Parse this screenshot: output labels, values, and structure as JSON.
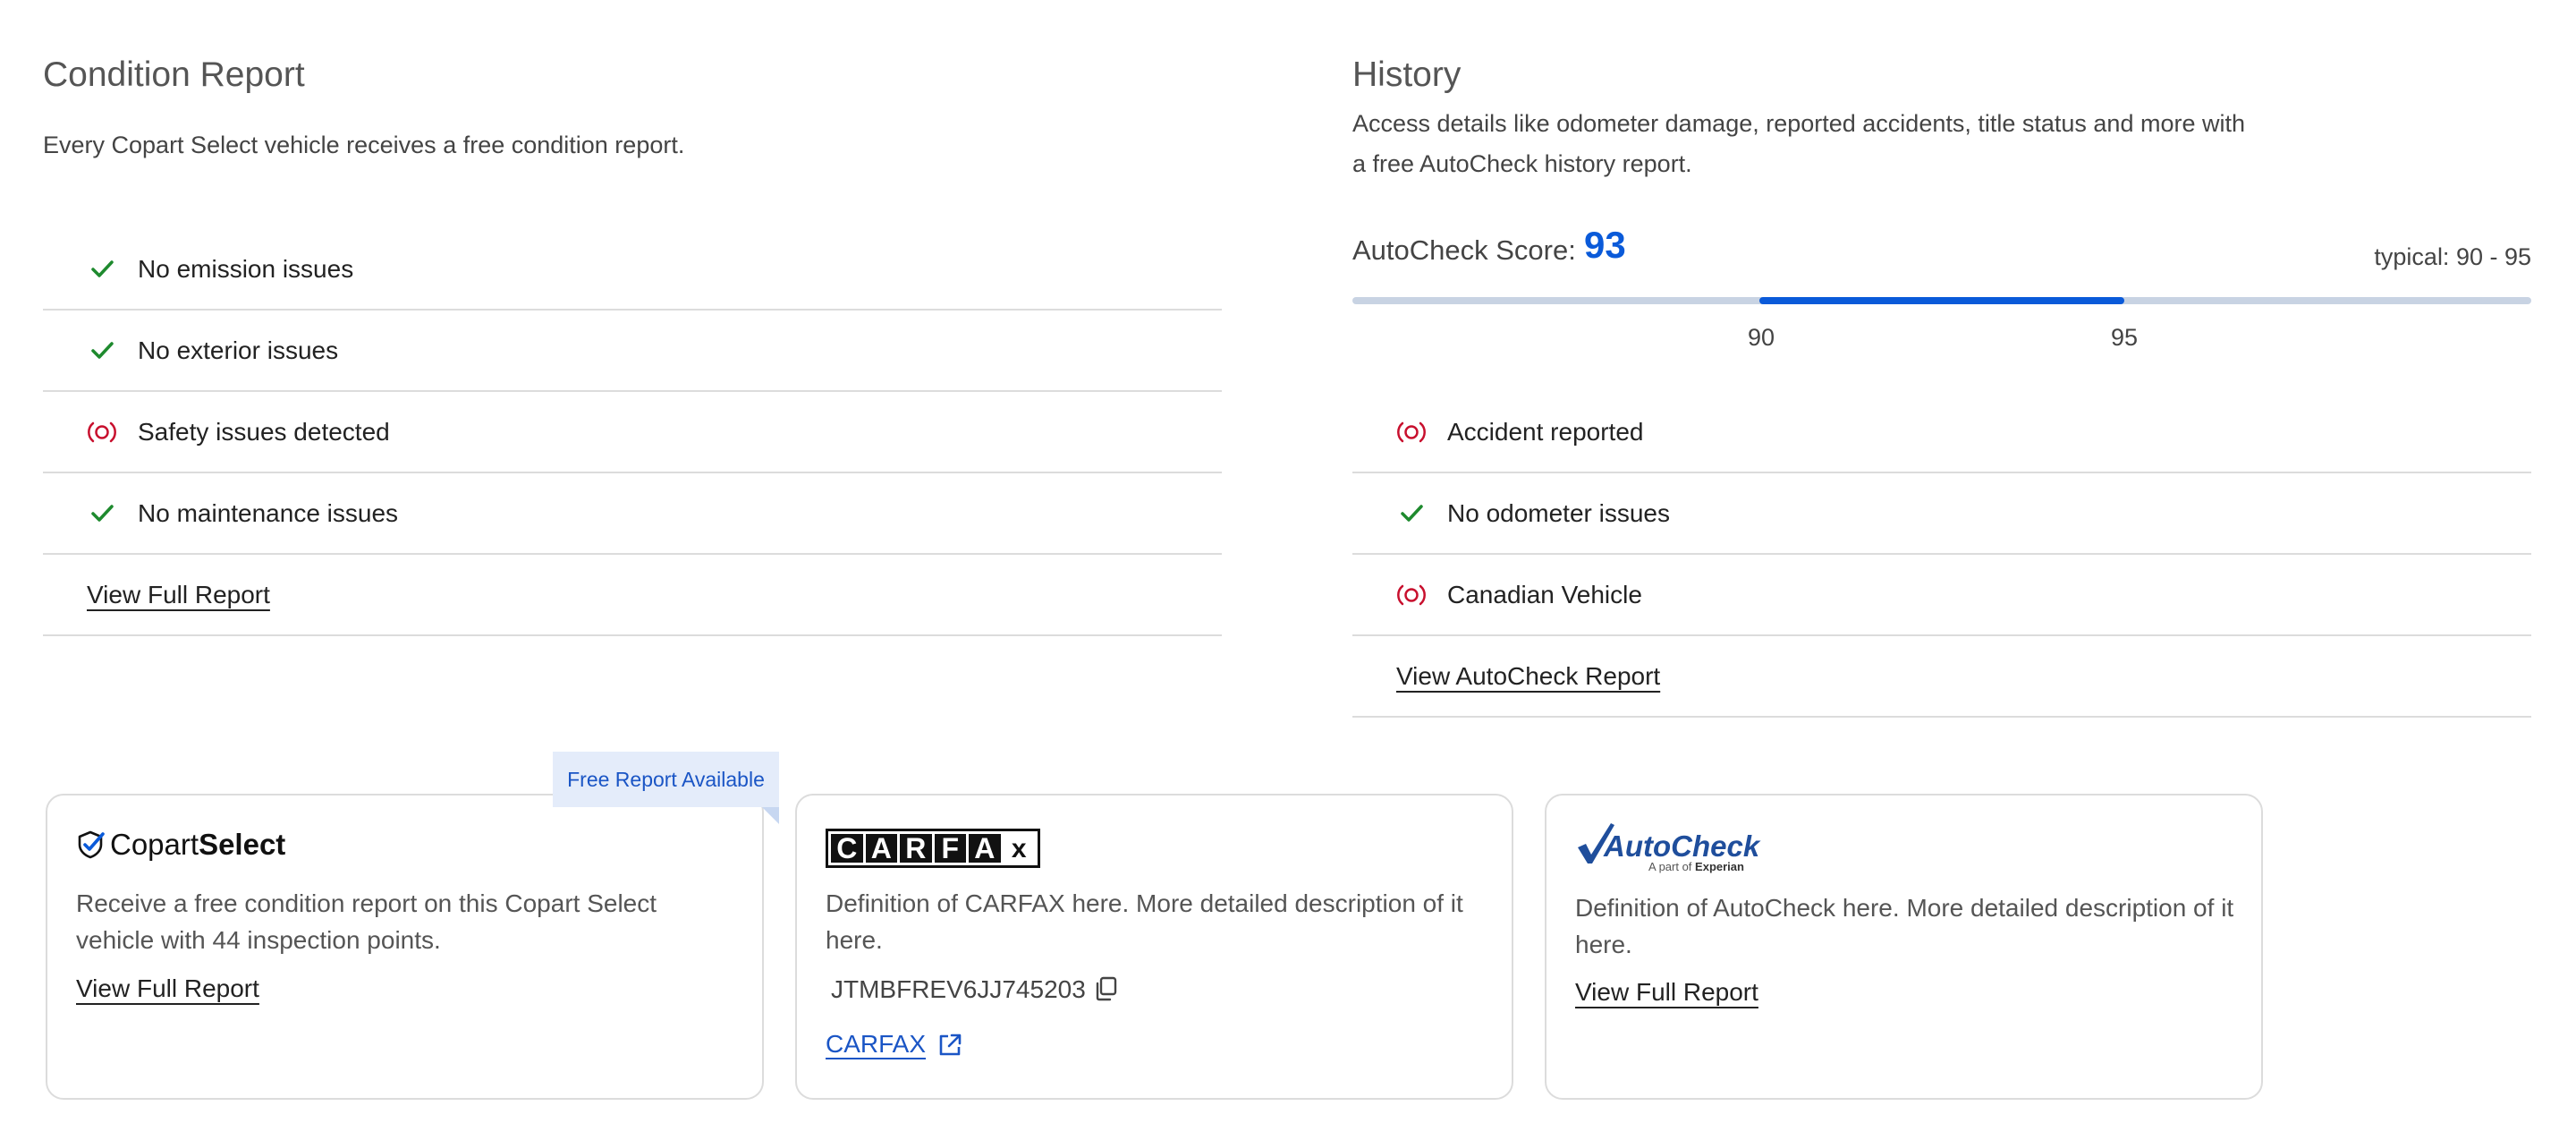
{
  "condition": {
    "title": "Condition Report",
    "subtitle": "Every Copart Select vehicle receives a free condition report.",
    "items": [
      {
        "label": "No emission issues",
        "status": "ok",
        "icon": "check-icon"
      },
      {
        "label": "No exterior issues",
        "status": "ok",
        "icon": "check-icon"
      },
      {
        "label": "Safety issues detected",
        "status": "alert",
        "icon": "alert-icon"
      },
      {
        "label": "No maintenance issues",
        "status": "ok",
        "icon": "check-icon"
      }
    ],
    "link": "View Full Report"
  },
  "history": {
    "title": "History",
    "subtitle": "Access details like odometer damage, reported accidents, title status and more with a free AutoCheck history report.",
    "score_label": "AutoCheck Score:",
    "score": "93",
    "typical": "typical: 90 - 95",
    "range": {
      "low": 90,
      "high": 95,
      "low_label": "90",
      "high_label": "95"
    },
    "items": [
      {
        "label": "Accident reported",
        "status": "alert",
        "icon": "alert-icon"
      },
      {
        "label": "No odometer issues",
        "status": "ok",
        "icon": "check-icon"
      },
      {
        "label": "Canadian Vehicle",
        "status": "alert",
        "icon": "alert-icon"
      }
    ],
    "link": "View AutoCheck Report"
  },
  "cards": {
    "copart": {
      "badge": "Free Report Available",
      "logo_light": "Copart",
      "logo_bold": "Select",
      "desc": "Receive a free condition report on this Copart Select vehicle with 44 inspection points.",
      "link": "View Full Report"
    },
    "carfax": {
      "logo": "CARFAX",
      "desc": "Definition of CARFAX here. More detailed description of it here.",
      "vin": "JTMBFREV6JJ745203",
      "link": "CARFAX"
    },
    "autocheck": {
      "logo": "AutoCheck",
      "logo_sub_light": "A part of",
      "logo_sub_bold": "Experian",
      "desc": "Definition of AutoCheck here. More detailed description of it here.",
      "link": "View Full Report"
    }
  },
  "colors": {
    "ok": "#1e8a2e",
    "alert": "#c8102e",
    "accent": "#0a5ad9",
    "autocheck": "#1f4e9c"
  }
}
